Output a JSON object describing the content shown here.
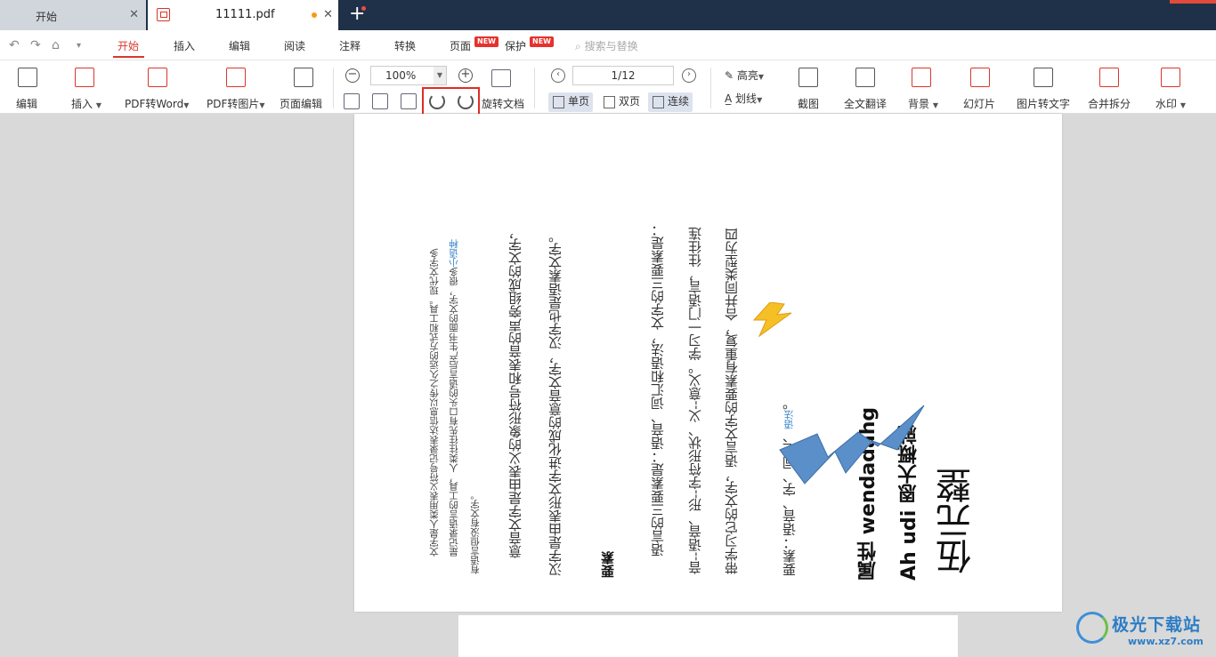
{
  "tabs": [
    {
      "label": "开始"
    },
    {
      "label": "11111.pdf"
    }
  ],
  "menu": {
    "items": [
      "开始",
      "插入",
      "编辑",
      "阅读",
      "注释",
      "转换",
      "页面",
      "保护"
    ],
    "new_badge": "NEW",
    "search_placeholder": "搜索与替换"
  },
  "toolbar": {
    "edit": "编辑",
    "insert": "插入",
    "pdf_to_word": "PDF转Word",
    "pdf_to_image": "PDF转图片",
    "page_edit": "页面编辑",
    "zoom_value": "100%",
    "rotate_doc": "旋转文档",
    "page_indicator": "1/12",
    "single_page": "单页",
    "double_page": "双页",
    "continuous": "连续",
    "highlight": "高亮",
    "strikethrough": "划线",
    "screenshot": "截图",
    "full_translate": "全文翻译",
    "background": "背景",
    "slideshow": "幻灯片",
    "image_to_text": "图片转文字",
    "merge_split": "合并拆分",
    "watermark": "水印"
  },
  "document": {
    "para1_line1": "文字是人类用表义符号记录表达信息以传之久远的方式和工具。现代文字多",
    "para1_line2a": "是记录语言的工具，人类往往先有口头的语言后产生书面的文字，很多",
    "para1_link": "小语种",
    "para1_line3": "有语言但没有文字。",
    "para2_line1": "意音文字是由表义的象形符号和表音的声旁组成的文字，",
    "para2_line2": "汉字是由表形文字进化成的意音文字，汉字也是语素文字。",
    "heading": "要素",
    "para3_line1": "语言的三要素是：语音、词汇和语法，文字的三要素是：",
    "para3_line2": "音--语音、形--字符形状、义--意义。学习一门语言，往往连",
    "para3_line3": "带学习它的文字，语言文字的要素有重复，合并同类型为四",
    "para3_line4a": "要素：语音、字、词汇、",
    "para3_link": "语法",
    "para3_line4b": "。",
    "big1": "属性 wendadahg",
    "big2": "Ah udi 恩大概就",
    "big3": "伍元整"
  },
  "watermark_text": {
    "title": "极光下载站",
    "url": "www.xz7.com"
  },
  "colors": {
    "accent": "#d9372d",
    "titlebar": "#1f3148",
    "link": "#3a86c8",
    "highlight_box": "#e02c23"
  }
}
